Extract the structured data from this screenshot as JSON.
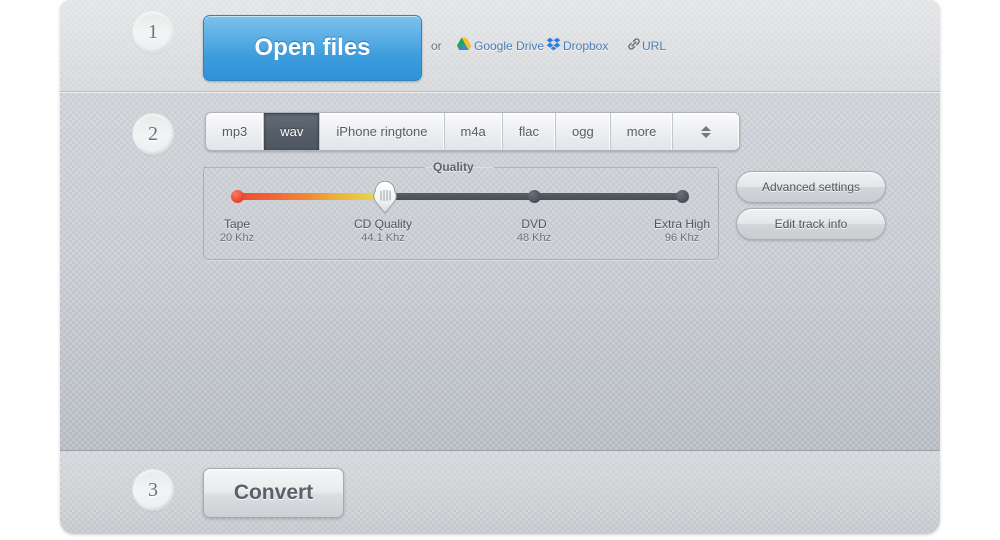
{
  "steps": {
    "one": "1",
    "two": "2",
    "three": "3"
  },
  "step1": {
    "open_files_label": "Open files",
    "or_label": "or",
    "sources": [
      {
        "label": "Google Drive",
        "icon": "google-drive-icon"
      },
      {
        "label": "Dropbox",
        "icon": "dropbox-icon"
      },
      {
        "label": "URL",
        "icon": "link-icon"
      }
    ]
  },
  "step2": {
    "formats": [
      {
        "label": "mp3",
        "selected": false
      },
      {
        "label": "wav",
        "selected": true
      },
      {
        "label": "iPhone ringtone",
        "selected": false
      },
      {
        "label": "m4a",
        "selected": false
      },
      {
        "label": "flac",
        "selected": false
      },
      {
        "label": "ogg",
        "selected": false
      },
      {
        "label": "more",
        "selected": false
      }
    ],
    "stepper_icon": "up-down-arrows-icon",
    "quality": {
      "legend": "Quality",
      "selected_index": 1,
      "stops": [
        {
          "name": "Tape",
          "rate": "20 Khz"
        },
        {
          "name": "CD Quality",
          "rate": "44.1 Khz"
        },
        {
          "name": "DVD",
          "rate": "48 Khz"
        },
        {
          "name": "Extra High",
          "rate": "96 Khz"
        }
      ]
    },
    "advanced_settings_label": "Advanced settings",
    "edit_track_info_label": "Edit track info"
  },
  "step3": {
    "convert_label": "Convert"
  },
  "colors": {
    "accent_blue": "#3d9ddd",
    "link_blue": "#4b7cb5",
    "selected_tab": "#565e69",
    "slider_low": "#ef4a35",
    "slider_mid": "#edb637",
    "slider_track": "#4a5059",
    "panel_light": "#dbdde0",
    "panel_body": "#bcc1c7"
  }
}
